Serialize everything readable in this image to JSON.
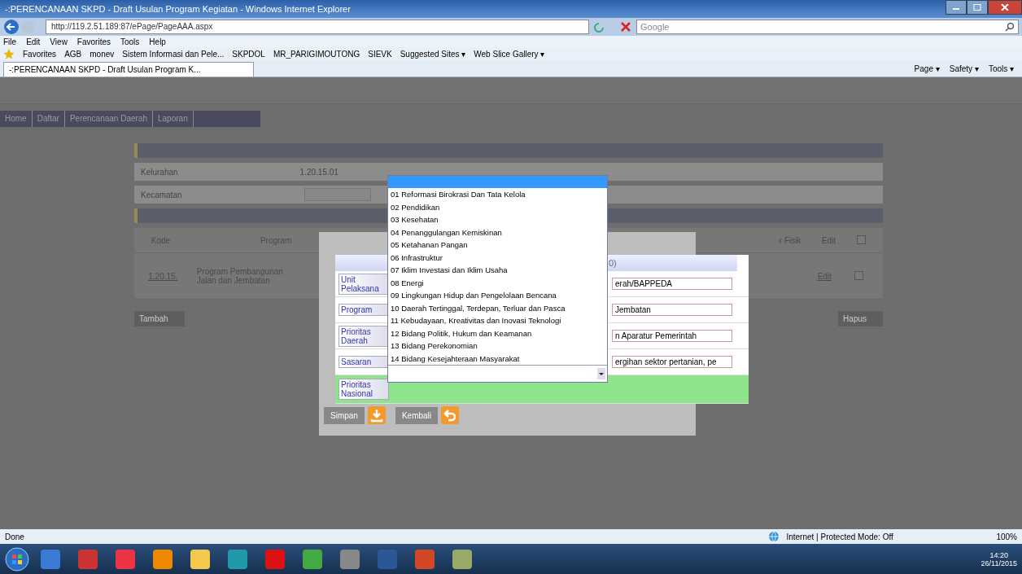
{
  "window": {
    "title": "-:PERENCANAAN SKPD - Draft Usulan Program Kegiatan - Windows Internet Explorer"
  },
  "address_bar": {
    "url": "http://119.2.51.189:87/ePage/PageAAA.aspx",
    "search_placeholder": "Google"
  },
  "menu": [
    "File",
    "Edit",
    "View",
    "Favorites",
    "Tools",
    "Help"
  ],
  "favorites_bar": {
    "label": "Favorites",
    "items": [
      "AGB",
      "monev",
      "Sistem Informasi dan Pele...",
      "SKPDOL",
      "MR_PARIGIMOUTONG",
      "SIEVK",
      "Suggested Sites ▾",
      "Web Slice Gallery ▾"
    ]
  },
  "tab": {
    "title": "-:PERENCANAAN SKPD - Draft Usulan Program K..."
  },
  "command_bar": [
    "Page ▾",
    "Safety ▾",
    "Tools ▾"
  ],
  "page": {
    "nav": [
      "Home",
      "Daftar",
      "Perencanaan Daerah",
      "Laporan"
    ],
    "form_rows": [
      {
        "label": "Kelurahan",
        "value": "1.20.15.01"
      },
      {
        "label": "Kecamatan"
      }
    ],
    "table": {
      "columns": [
        "Kode",
        "Program",
        "r Fisik",
        "Edit"
      ],
      "header_checked": false,
      "rows": [
        {
          "kode": "1.20.15.",
          "program": "Program Pembangunan Jalan dan Jembatan",
          "edit": "Edit",
          "checked": false
        }
      ]
    },
    "buttons": [
      "Tambah",
      "Hapus"
    ]
  },
  "dialog": {
    "header_value": "0)",
    "fields": [
      {
        "label": "Unit Pelaksana",
        "value": "erah/BAPPEDA"
      },
      {
        "label": "Program",
        "value": "Jembatan"
      },
      {
        "label": "Prioritas Daerah",
        "value": "n Aparatur Pemerintah"
      },
      {
        "label": "Sasaran",
        "value": "ergihan sektor pertanian, pe"
      },
      {
        "label": "Prioritas Nasional"
      }
    ],
    "buttons": [
      "Simpan",
      "Kembali"
    ]
  },
  "dropdown": {
    "options": [
      {
        "label": "01 Reformasi Birokrasi Dan Tata Kelola",
        "selected": false
      },
      {
        "label": "02 Pendidikan",
        "selected": false
      },
      {
        "label": "03 Kesehatan",
        "selected": false
      },
      {
        "label": "04 Penanggulangan Kemiskinan",
        "selected": false
      },
      {
        "label": "05 Ketahanan Pangan",
        "selected": false
      },
      {
        "label": "06 Infrastruktur",
        "selected": false
      },
      {
        "label": "07 Iklim Investasi dan Iklim Usaha",
        "selected": false
      },
      {
        "label": "08 Energi",
        "selected": false
      },
      {
        "label": "09 Lingkungan Hidup dan Pengelolaan Bencana",
        "selected": false
      },
      {
        "label": "10 Daerah Tertinggal, Terdepan, Terluar dan Pasca",
        "selected": false
      },
      {
        "label": "11 Kebudayaan, Kreativitas dan Inovasi Teknologi",
        "selected": false
      },
      {
        "label": "12 Bidang Politik, Hukum dan Keamanan",
        "selected": false
      },
      {
        "label": "13 Bidang Perekonomian",
        "selected": false
      },
      {
        "label": "14 Bidang Kesejahteraan Masyarakat",
        "selected": false
      }
    ]
  },
  "status_bar": {
    "text": "Done",
    "zone": "Internet | Protected Mode: Off",
    "zoom": "100%"
  },
  "taskbar": {
    "time": "14:20",
    "date": "26/11/2015"
  }
}
